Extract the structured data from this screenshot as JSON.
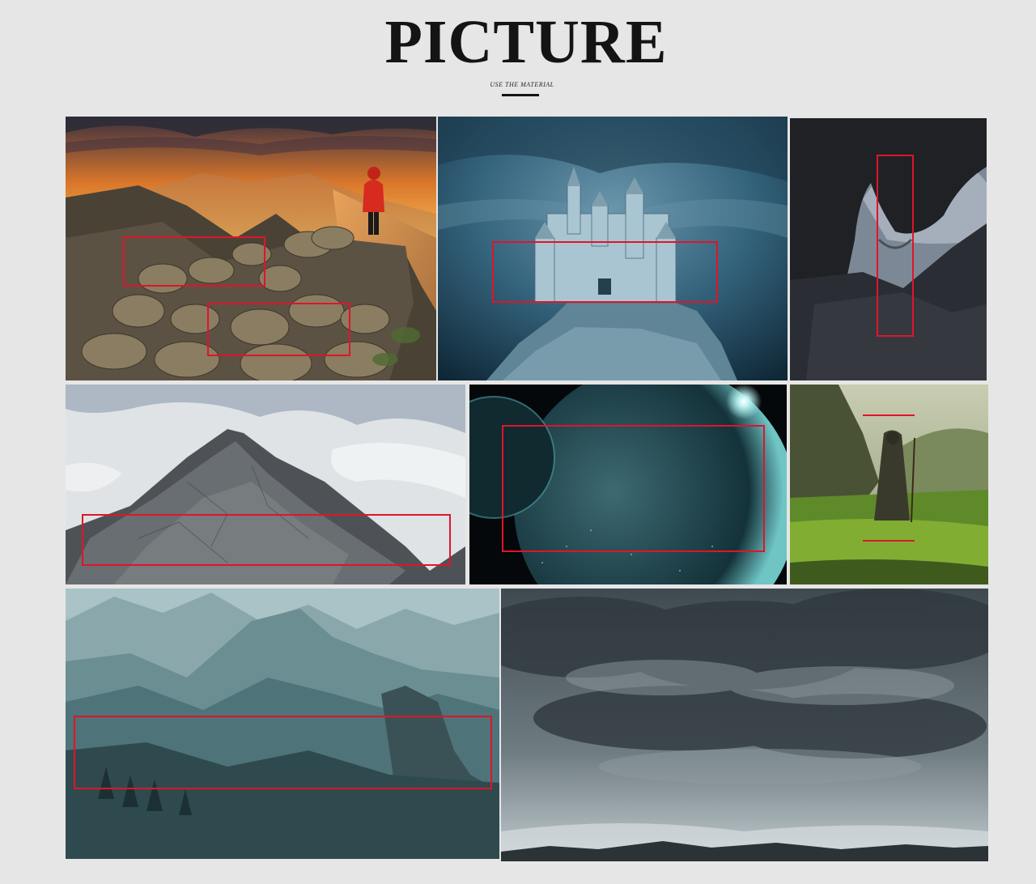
{
  "header": {
    "title": "PICTURE",
    "subtitle": "USE THE MATERIAL"
  },
  "colors": {
    "background": "#e6e6e6",
    "title": "#141414",
    "highlight_box": "#e0142a"
  },
  "gallery": {
    "tiles": [
      {
        "id": "sunset-ridge-hiker"
      },
      {
        "id": "castle-on-rock"
      },
      {
        "id": "cave-arch"
      },
      {
        "id": "misty-peak"
      },
      {
        "id": "planet-in-space"
      },
      {
        "id": "cloaked-wanderer"
      },
      {
        "id": "misty-valley"
      },
      {
        "id": "storm-clouds"
      }
    ]
  }
}
